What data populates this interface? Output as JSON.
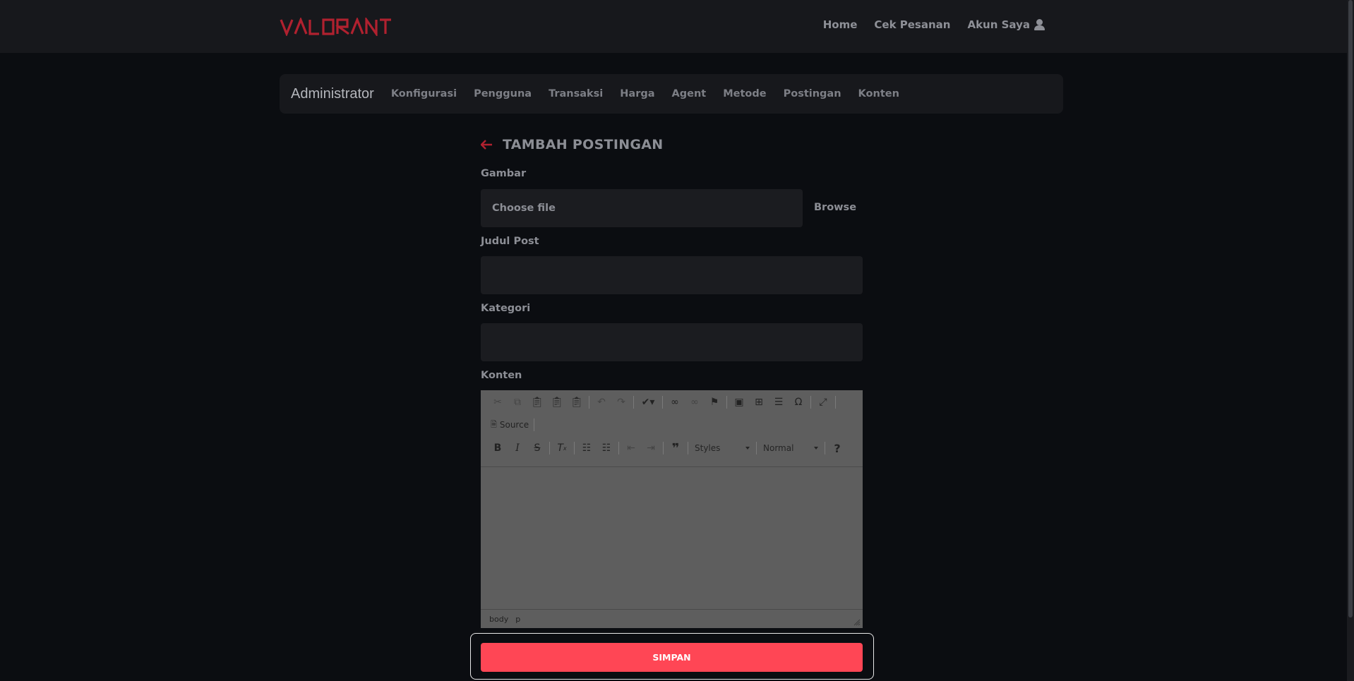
{
  "header": {
    "logo_text": "VALORANT",
    "nav": [
      "Home",
      "Cek Pesanan",
      "Akun Saya"
    ]
  },
  "admin": {
    "brand": "Administrator",
    "links": [
      "Konfigurasi",
      "Pengguna",
      "Transaksi",
      "Harga",
      "Agent",
      "Metode",
      "Postingan",
      "Konten"
    ]
  },
  "form": {
    "title": "TAMBAH POSTINGAN",
    "image_label": "Gambar",
    "file_placeholder": "Choose file",
    "browse_label": "Browse",
    "title_label": "Judul Post",
    "title_value": "",
    "category_label": "Kategori",
    "category_value": "",
    "content_label": "Konten"
  },
  "editor": {
    "source_label": "Source",
    "styles_label": "Styles",
    "format_label": "Normal",
    "path": [
      "body",
      "p"
    ]
  },
  "actions": {
    "save_label": "SIMPAN"
  },
  "colors": {
    "accent": "#ff4655",
    "background": "#0b0d11",
    "panel": "#17181c"
  }
}
